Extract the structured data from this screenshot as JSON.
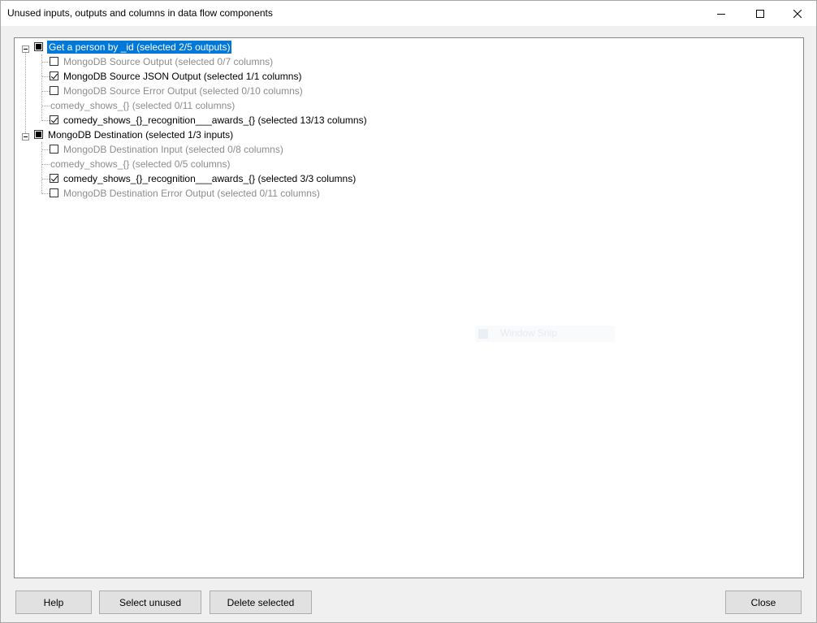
{
  "window": {
    "title": "Unused inputs, outputs and columns in data flow components"
  },
  "titlebar": {
    "minimize_icon": "minimize-icon",
    "maximize_icon": "maximize-icon",
    "close_icon": "close-icon"
  },
  "tree": {
    "nodes": [
      {
        "label": "Get a person by _id (selected 2/5 outputs)",
        "check": "mixed",
        "selected": true
      },
      {
        "label": "MongoDB Source Output (selected 0/7 columns)",
        "check": "unchecked"
      },
      {
        "label": "MongoDB Source JSON Output (selected 1/1 columns)",
        "check": "checked"
      },
      {
        "label": "MongoDB Source Error Output (selected 0/10 columns)",
        "check": "unchecked"
      },
      {
        "label": "comedy_shows_{} (selected 0/11 columns)",
        "check": "none"
      },
      {
        "label": "comedy_shows_{}_recognition___awards_{} (selected 13/13 columns)",
        "check": "checked"
      },
      {
        "label": "MongoDB Destination (selected 1/3 inputs)",
        "check": "mixed"
      },
      {
        "label": "MongoDB Destination Input (selected 0/8 columns)",
        "check": "unchecked"
      },
      {
        "label": "comedy_shows_{} (selected 0/5 columns)",
        "check": "none"
      },
      {
        "label": "comedy_shows_{}_recognition___awards_{} (selected 3/3 columns)",
        "check": "checked"
      },
      {
        "label": "MongoDB Destination Error Output (selected 0/11 columns)",
        "check": "unchecked"
      }
    ]
  },
  "buttons": {
    "help": "Help",
    "select_unused": "Select unused",
    "delete_selected": "Delete selected",
    "close": "Close"
  },
  "overlay": {
    "snap_text": "Window Snip"
  },
  "colors": {
    "selection": "#0078d7",
    "dim_text": "#8c8c8c"
  }
}
